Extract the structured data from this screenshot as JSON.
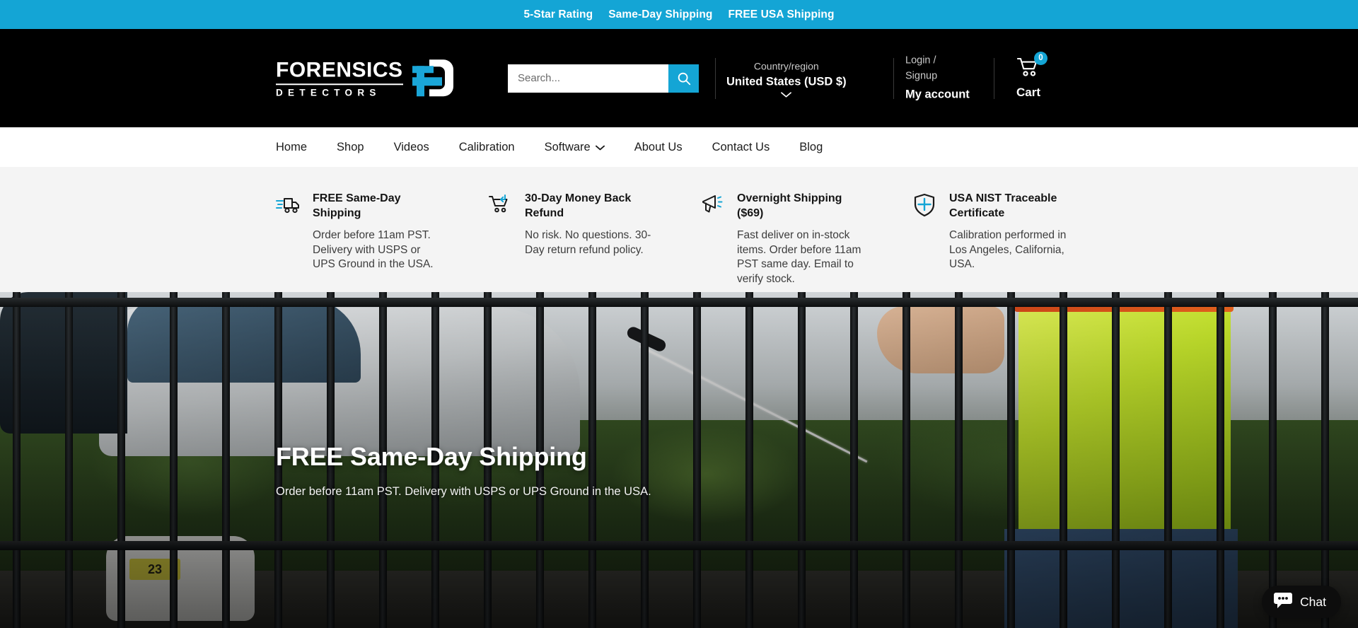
{
  "announcement": {
    "items": [
      {
        "label": "5-Star Rating"
      },
      {
        "label": "Same-Day Shipping"
      },
      {
        "label": "FREE USA Shipping"
      }
    ],
    "bg_color": "#14a5d5"
  },
  "header": {
    "logo": {
      "top": "FORENSICS",
      "bottom": "DETECTORS",
      "mark": "fd-monogram"
    },
    "search": {
      "placeholder": "Search...",
      "value": "",
      "button_icon": "search-icon",
      "button_color": "#14a5d5"
    },
    "country": {
      "label": "Country/region",
      "value": "United States (USD $)",
      "chevron": "chevron-down-icon"
    },
    "account": {
      "line1": "Login /",
      "line2": "Signup",
      "line3": "My account"
    },
    "cart": {
      "label": "Cart",
      "count": "0",
      "icon": "cart-icon",
      "badge_color": "#14a5d5"
    }
  },
  "nav": {
    "items": [
      {
        "label": "Home",
        "has_dropdown": false
      },
      {
        "label": "Shop",
        "has_dropdown": false
      },
      {
        "label": "Videos",
        "has_dropdown": false
      },
      {
        "label": "Calibration",
        "has_dropdown": false
      },
      {
        "label": "Software",
        "has_dropdown": true
      },
      {
        "label": "About Us",
        "has_dropdown": false
      },
      {
        "label": "Contact Us",
        "has_dropdown": false
      },
      {
        "label": "Blog",
        "has_dropdown": false
      }
    ]
  },
  "features": [
    {
      "icon": "delivery-truck-icon",
      "title": "FREE Same-Day Shipping",
      "desc": "Order before 11am PST. Delivery with USPS or UPS Ground in the USA."
    },
    {
      "icon": "cart-return-icon",
      "title": "30-Day Money Back Refund",
      "desc": "No risk. No questions. 30-Day return refund policy."
    },
    {
      "icon": "megaphone-icon",
      "title": "Overnight Shipping ($69)",
      "desc": "Fast deliver on in-stock items. Order before 11am PST same day. Email to verify stock."
    },
    {
      "icon": "shield-check-icon",
      "title": "USA NIST Traceable Certificate",
      "desc": "Calibration performed in Los Angeles, California, USA."
    }
  ],
  "hero": {
    "title": "FREE Same-Day Shipping",
    "subtitle": "Order before 11am PST. Delivery with USPS or UPS Ground in the USA.",
    "meter_reading": "23"
  },
  "chat": {
    "label": "Chat",
    "icon": "chat-bubble-icon"
  }
}
